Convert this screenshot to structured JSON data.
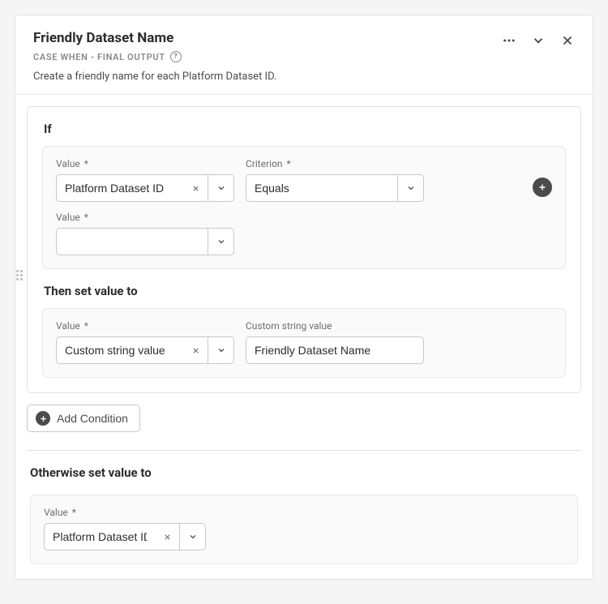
{
  "header": {
    "title": "Friendly Dataset Name",
    "subtitle": "CASE WHEN - FINAL OUTPUT",
    "description": "Create a friendly name for each Platform Dataset ID."
  },
  "if_section": {
    "title": "If",
    "value1": {
      "label": "Value",
      "value": "Platform Dataset ID"
    },
    "criterion": {
      "label": "Criterion",
      "value": "Equals"
    },
    "value2": {
      "label": "Value",
      "value": ""
    }
  },
  "then_section": {
    "title": "Then set value to",
    "value": {
      "label": "Value",
      "value": "Custom string value"
    },
    "custom": {
      "label": "Custom string value",
      "value": "Friendly Dataset Name"
    }
  },
  "add_condition_label": "Add Condition",
  "otherwise_section": {
    "title": "Otherwise set value to",
    "value": {
      "label": "Value",
      "value": "Platform Dataset ID"
    }
  }
}
